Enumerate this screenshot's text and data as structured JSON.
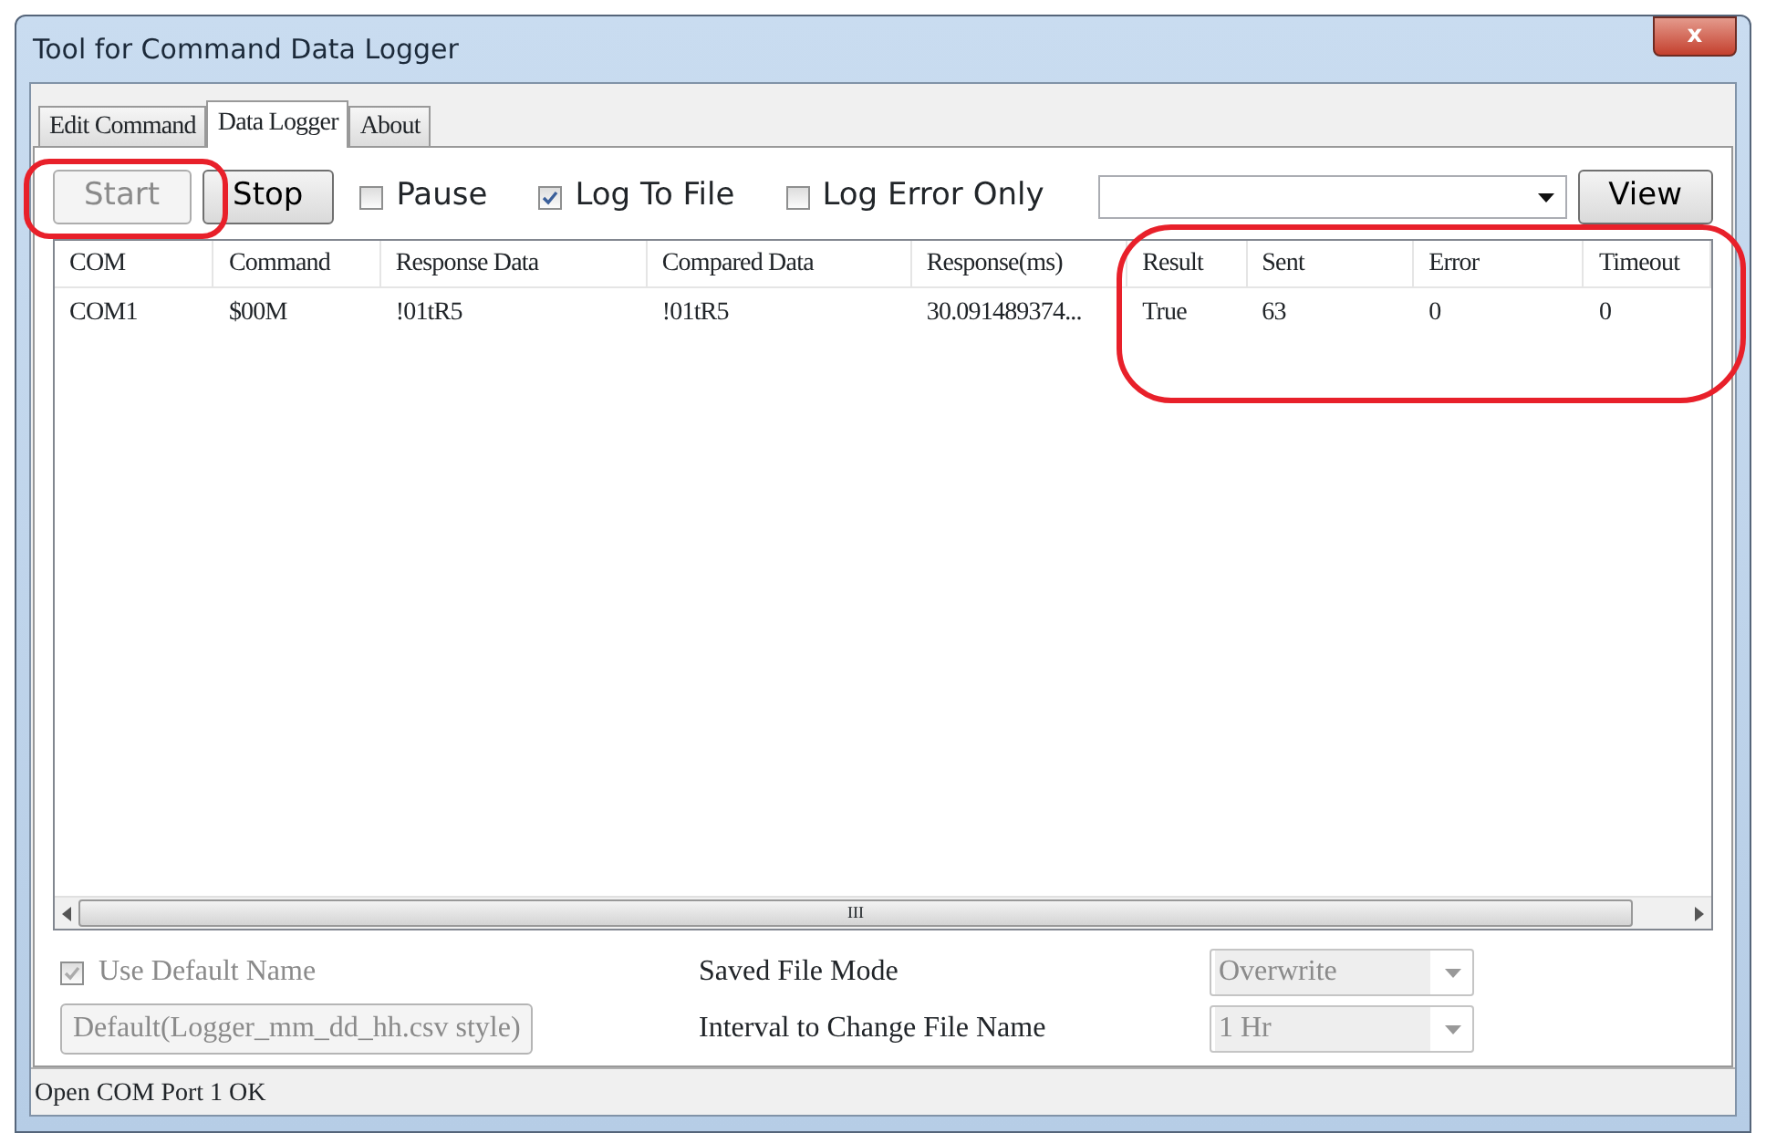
{
  "window": {
    "title": "Tool for Command Data Logger",
    "close": "x"
  },
  "tabs": [
    {
      "label": "Edit Command",
      "selected": false
    },
    {
      "label": "Data Logger",
      "selected": true
    },
    {
      "label": "About",
      "selected": false
    }
  ],
  "toolbar": {
    "buttons": [
      {
        "label": "Start",
        "disabled": true
      },
      {
        "label": "Stop",
        "disabled": false
      }
    ],
    "checkboxes": [
      {
        "label": "Pause",
        "checked": false
      },
      {
        "label": "Log To File",
        "checked": true
      },
      {
        "label": "Log Error Only",
        "checked": false
      }
    ],
    "view_button": "View"
  },
  "table": {
    "columns": [
      "COM",
      "Command",
      "Response Data",
      "Compared Data",
      "Response(ms)",
      "Result",
      "Sent",
      "Error",
      "Timeout"
    ],
    "rows": [
      [
        "COM1",
        "$00M",
        "!01tR5",
        "!01tR5",
        "30.091489374...",
        "True",
        "63",
        "0",
        "0"
      ]
    ],
    "scrollbar_grip": "III"
  },
  "options": {
    "use_default_name": {
      "label": "Use Default Name",
      "checked": true,
      "disabled": true
    },
    "default_button": "Default(Logger_mm_dd_hh.csv style)",
    "saved_file_mode": {
      "label": "Saved File Mode",
      "value": "Overwrite"
    },
    "interval": {
      "label": "Interval to Change File Name",
      "value": "1 Hr"
    }
  },
  "status_bar": "Open COM Port 1 OK"
}
